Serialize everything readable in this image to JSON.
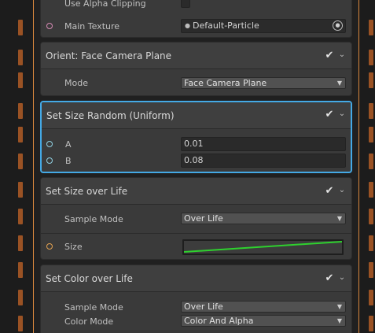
{
  "top": {
    "use_alpha_clipping": "Use Alpha Clipping",
    "main_texture_label": "Main Texture",
    "main_texture_value": "Default-Particle"
  },
  "orient": {
    "title": "Orient: Face Camera Plane",
    "mode_label": "Mode",
    "mode_value": "Face Camera Plane"
  },
  "size_random": {
    "title": "Set Size Random (Uniform)",
    "a_label": "A",
    "a_value": "0.01",
    "b_label": "B",
    "b_value": "0.08"
  },
  "size_over_life": {
    "title": "Set Size over Life",
    "sample_mode_label": "Sample Mode",
    "sample_mode_value": "Over Life",
    "size_label": "Size"
  },
  "color_over_life": {
    "title": "Set Color over Life",
    "sample_mode_label": "Sample Mode",
    "sample_mode_value": "Over Life",
    "color_mode_label": "Color Mode",
    "color_mode_value": "Color And Alpha"
  },
  "colors": {
    "selection": "#44a9e5",
    "curve": "#2ed12e",
    "flow": "#d9883d"
  }
}
